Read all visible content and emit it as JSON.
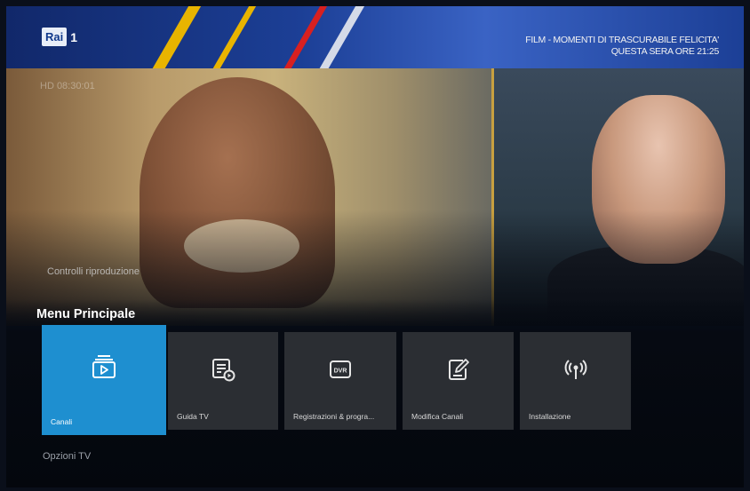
{
  "channel": {
    "logo_text": "Rai",
    "number": "1"
  },
  "promo": {
    "line1": "FILM - MOMENTI DI TRASCURABILE FELICITA'",
    "line2": "QUESTA SERA ORE 21:25"
  },
  "video": {
    "overlay_text": "HD 08:30:01",
    "controls_label": "Controlli riproduzione"
  },
  "menu": {
    "title": "Menu Principale",
    "items": [
      {
        "label": "Canali",
        "icon": "channels-play-icon",
        "selected": true
      },
      {
        "label": "Guida TV",
        "icon": "tv-guide-icon",
        "selected": false
      },
      {
        "label": "Registrazioni & progra...",
        "icon": "dvr-icon",
        "selected": false
      },
      {
        "label": "Modifica Canali",
        "icon": "edit-channels-icon",
        "selected": false
      },
      {
        "label": "Installazione",
        "icon": "installation-antenna-icon",
        "selected": false
      }
    ]
  },
  "secondary": {
    "label": "Opzioni TV"
  },
  "colors": {
    "accent": "#1e8fd0",
    "tile_bg": "#2b2e33",
    "banner": "#1c3f96"
  }
}
